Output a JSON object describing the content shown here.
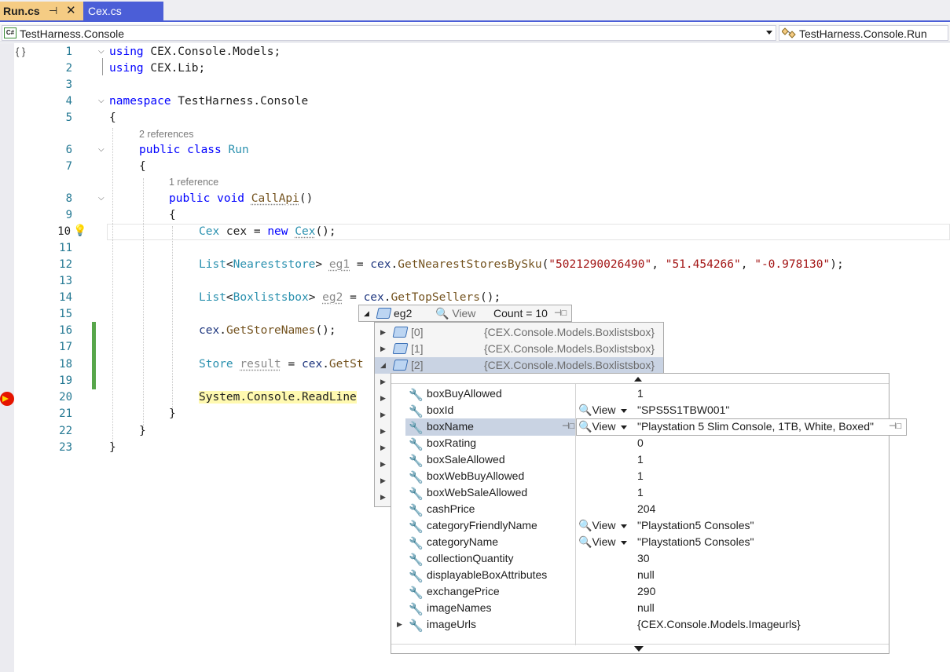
{
  "tabs": {
    "active": {
      "label": "Run.cs",
      "pin": "⊣",
      "close": "✕"
    },
    "inactive": {
      "label": "Cex.cs"
    }
  },
  "navbar": {
    "project_icon": "C#",
    "project": "TestHarness.Console",
    "member": "TestHarness.Console.Run"
  },
  "editor": {
    "line_numbers": [
      "1",
      "2",
      "3",
      "4",
      "5",
      "6",
      "7",
      "8",
      "9",
      "10",
      "11",
      "12",
      "13",
      "14",
      "15",
      "16",
      "17",
      "18",
      "19",
      "20",
      "21",
      "22",
      "23"
    ],
    "codelens": [
      "2 references",
      "1 reference"
    ],
    "code": {
      "l1_kw": "using",
      "l1_rest": " CEX.Console.Models;",
      "l2_kw": "using",
      "l2_rest": " CEX.Lib;",
      "l4_kw": "namespace",
      "l4_rest": " TestHarness.Console",
      "l5": "{",
      "l6_kw1": "public",
      "l6_kw2": " class ",
      "l6_ty": "Run",
      "l7": "{",
      "l8_kw1": "public",
      "l8_kw2": " void ",
      "l8_me": "CallApi",
      "l8_rest": "()",
      "l9": "{",
      "l10_ty": "Cex",
      "l10_a": " cex = ",
      "l10_kw": "new",
      "l10_sp": " ",
      "l10_ty2": "Cex",
      "l10_b": "();",
      "l12_ty": "List",
      "l12_lt": "<",
      "l12_ty2": "Neareststore",
      "l12_gt": "> ",
      "l12_var": "eg1",
      "l12_eq": " = ",
      "l12_lo": "cex",
      "l12_dot": ".",
      "l12_me": "GetNearestStoresBySku",
      "l12_p": "(",
      "l12_s1": "\"5021290026490\"",
      "l12_c1": ", ",
      "l12_s2": "\"51.454266\"",
      "l12_c2": ", ",
      "l12_s3": "\"-0.978130\"",
      "l12_end": ");",
      "l14_ty": "List",
      "l14_lt": "<",
      "l14_ty2": "Boxlistsbox",
      "l14_gt": "> ",
      "l14_var": "eg2",
      "l14_eq": " = ",
      "l14_lo": "cex",
      "l14_dot": ".",
      "l14_me": "GetTopSellers",
      "l14_end": "();",
      "l16_lo": "cex",
      "l16_dot": ".",
      "l16_me": "GetStoreNames",
      "l16_end": "();",
      "l18_ty": "Store",
      "l18_sp": " ",
      "l18_var": "result",
      "l18_eq": " = ",
      "l18_lo": "cex",
      "l18_dot": ".",
      "l18_me": "GetSt",
      "l20_a": "System.",
      "l20_ty": "Console",
      "l20_dot": ".",
      "l20_me": "ReadLine",
      "l21": "}",
      "l22": "}",
      "l23": "}"
    }
  },
  "datatip": {
    "name": "eg2",
    "view_label": "View",
    "count": "Count = 10",
    "items": [
      {
        "name": "[0]",
        "value": "{CEX.Console.Models.Boxlistsbox}"
      },
      {
        "name": "[1]",
        "value": "{CEX.Console.Models.Boxlistsbox}"
      },
      {
        "name": "[2]",
        "value": "{CEX.Console.Models.Boxlistsbox}"
      }
    ],
    "properties": [
      {
        "name": "boxBuyAllowed",
        "value": "1",
        "view": ""
      },
      {
        "name": "boxId",
        "value": "\"SPS5S1TBW001\"",
        "view": "View"
      },
      {
        "name": "boxName",
        "value": "\"Playstation 5 Slim Console, 1TB, White, Boxed\"",
        "view": "View"
      },
      {
        "name": "boxRating",
        "value": "0",
        "view": ""
      },
      {
        "name": "boxSaleAllowed",
        "value": "1",
        "view": ""
      },
      {
        "name": "boxWebBuyAllowed",
        "value": "1",
        "view": ""
      },
      {
        "name": "boxWebSaleAllowed",
        "value": "1",
        "view": ""
      },
      {
        "name": "cashPrice",
        "value": "204",
        "view": ""
      },
      {
        "name": "categoryFriendlyName",
        "value": "\"Playstation5 Consoles\"",
        "view": "View"
      },
      {
        "name": "categoryName",
        "value": "\"Playstation5 Consoles\"",
        "view": "View"
      },
      {
        "name": "collectionQuantity",
        "value": "30",
        "view": ""
      },
      {
        "name": "displayableBoxAttributes",
        "value": "null",
        "view": ""
      },
      {
        "name": "exchangePrice",
        "value": "290",
        "view": ""
      },
      {
        "name": "imageNames",
        "value": "null",
        "view": ""
      },
      {
        "name": "imageUrls",
        "value": "{CEX.Console.Models.Imageurls}",
        "view": ""
      }
    ]
  },
  "colors": {
    "accent": "#4b5ed7",
    "active_tab": "#f5cc84",
    "change_bar": "#57a64a",
    "breakpoint": "#e51400",
    "current_stmt": "#fff9b0"
  }
}
